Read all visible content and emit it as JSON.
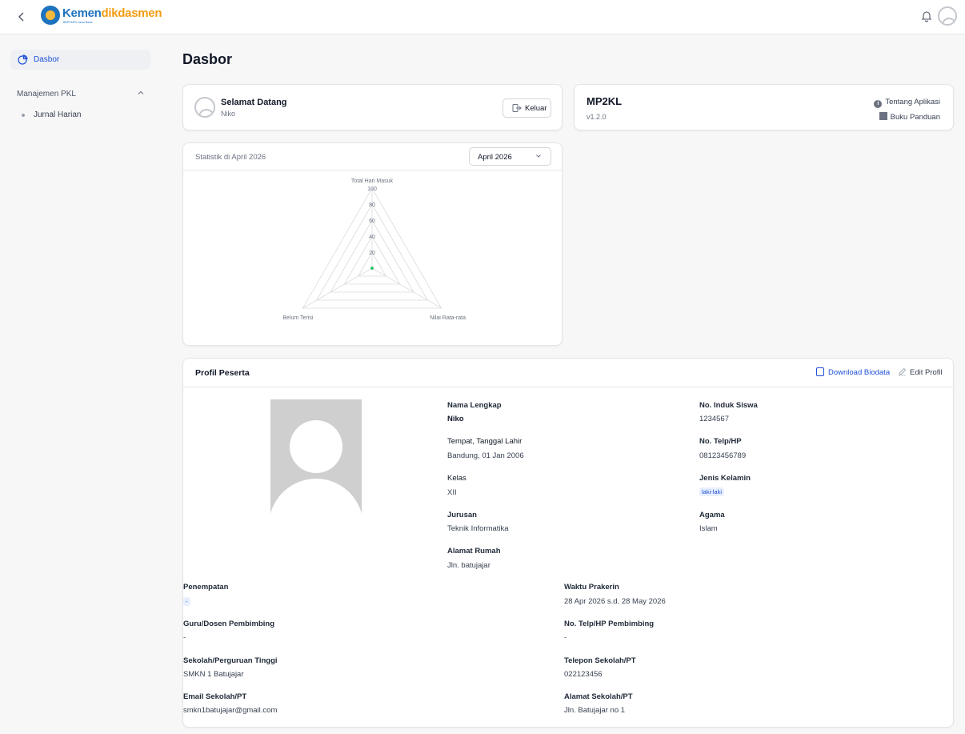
{
  "header": {
    "brand_main": "Kemen",
    "brand_accent": "dikdasmen",
    "brand_sub": "BBPPMPV Jawa Barat",
    "icons": [
      "chevron-left-icon",
      "bell-icon",
      "user-avatar-icon"
    ]
  },
  "sidebar": {
    "active_item": "Dasbor",
    "group_label": "Manajemen PKL",
    "sub_item": "Jurnal Harian"
  },
  "page": {
    "title": "Dasbor"
  },
  "welcome": {
    "title": "Selamat Datang",
    "name": "Niko",
    "logout_label": "Keluar"
  },
  "app": {
    "name": "MP2KL",
    "version": "v1.2.0",
    "about_label": "Tentang Aplikasi",
    "guide_label": "Buku Panduan"
  },
  "stats": {
    "title": "Statistik di April 2026",
    "month_selected": "April 2026"
  },
  "chart_data": {
    "type": "radar",
    "axes": [
      "Total Hari Masuk",
      "Nilai Rata-rata",
      "Belum Terisi"
    ],
    "tick_labels": [
      "20",
      "40",
      "60",
      "80",
      "100"
    ],
    "range": [
      0,
      100
    ],
    "values": [
      0,
      0,
      0
    ],
    "point_color": "#22c55e"
  },
  "profile": {
    "title": "Profil Peserta",
    "download_label": "Download Biodata",
    "edit_label": "Edit Profil",
    "fields": {
      "nama_label": "Nama Lengkap",
      "nama_value": "Niko",
      "ttl_label": "Tempat, Tanggal Lahir",
      "ttl_value": "Bandung, 01 Jan 2006",
      "kelas_label": "Kelas",
      "kelas_value": "XII",
      "jurusan_label": "Jurusan",
      "jurusan_value": "Teknik Informatika",
      "alamat_label": "Alamat Rumah",
      "alamat_value": "Jln. batujajar",
      "nis_label": "No. Induk Siswa",
      "nis_value": "1234567",
      "telp_label": "No. Telp/HP",
      "telp_value": "08123456789",
      "jk_label": "Jenis Kelamin",
      "jk_value": "laki-laki",
      "agama_label": "Agama",
      "agama_value": "Islam",
      "penempatan_label": "Penempatan",
      "penempatan_value": "-",
      "waktu_label": "Waktu Prakerin",
      "waktu_value": "28 Apr 2026 s.d. 28 May 2026",
      "guru_label": "Guru/Dosen Pembimbing",
      "guru_value": "-",
      "telp_pemb_label": "No. Telp/HP Pembimbing",
      "telp_pemb_value": "-",
      "sekolah_label": "Sekolah/Perguruan Tinggi",
      "sekolah_value": "SMKN 1 Batujajar",
      "telp_sekolah_label": "Telepon Sekolah/PT",
      "telp_sekolah_value": "022123456",
      "email_label": "Email Sekolah/PT",
      "email_value": "smkn1batujajar@gmail.com",
      "alamat_sekolah_label": "Alamat Sekolah/PT",
      "alamat_sekolah_value": "Jln. Batujajar no 1"
    }
  },
  "colors": {
    "accent": "#1d4ed8",
    "brand_blue": "#1e73be",
    "brand_orange": "#f39c12"
  }
}
